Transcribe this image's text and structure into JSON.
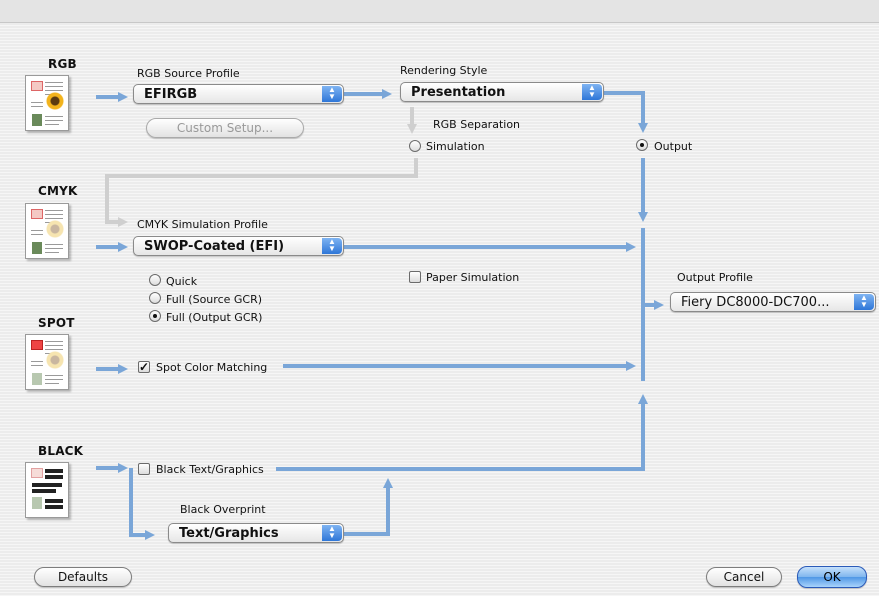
{
  "sections": {
    "rgb": "RGB",
    "cmyk": "CMYK",
    "spot": "SPOT",
    "black": "BLACK"
  },
  "rgb": {
    "source_profile_label": "RGB Source Profile",
    "source_profile_value": "EFIRGB",
    "custom_setup_label": "Custom Setup...",
    "rendering_style_label": "Rendering Style",
    "rendering_style_value": "Presentation",
    "separation_label": "RGB Separation",
    "separation_options": [
      "Simulation",
      "Output"
    ],
    "separation_selected": "Output"
  },
  "cmyk": {
    "simulation_profile_label": "CMYK Simulation Profile",
    "simulation_profile_value": "SWOP-Coated (EFI)",
    "method_options": [
      "Quick",
      "Full (Source GCR)",
      "Full (Output GCR)"
    ],
    "method_selected": "Full (Output GCR)",
    "paper_simulation_label": "Paper Simulation",
    "paper_simulation_checked": false
  },
  "spot": {
    "color_matching_label": "Spot Color Matching",
    "color_matching_checked": true
  },
  "black": {
    "text_graphics_label": "Black Text/Graphics",
    "text_graphics_checked": false,
    "overprint_label": "Black Overprint",
    "overprint_value": "Text/Graphics"
  },
  "output": {
    "profile_label": "Output Profile",
    "profile_value": "Fiery DC8000-DC700..."
  },
  "buttons": {
    "defaults": "Defaults",
    "cancel": "Cancel",
    "ok": "OK"
  },
  "colors": {
    "flow_arrow": "#7aa6d8",
    "disabled_flow_arrow": "#cfcfcf",
    "default_button": "#5aa0ea"
  },
  "icons": {
    "popup_arrows": "up-down-arrows-icon",
    "radio_selected": "radio-on",
    "checkbox_checked": "checkmark-icon"
  }
}
